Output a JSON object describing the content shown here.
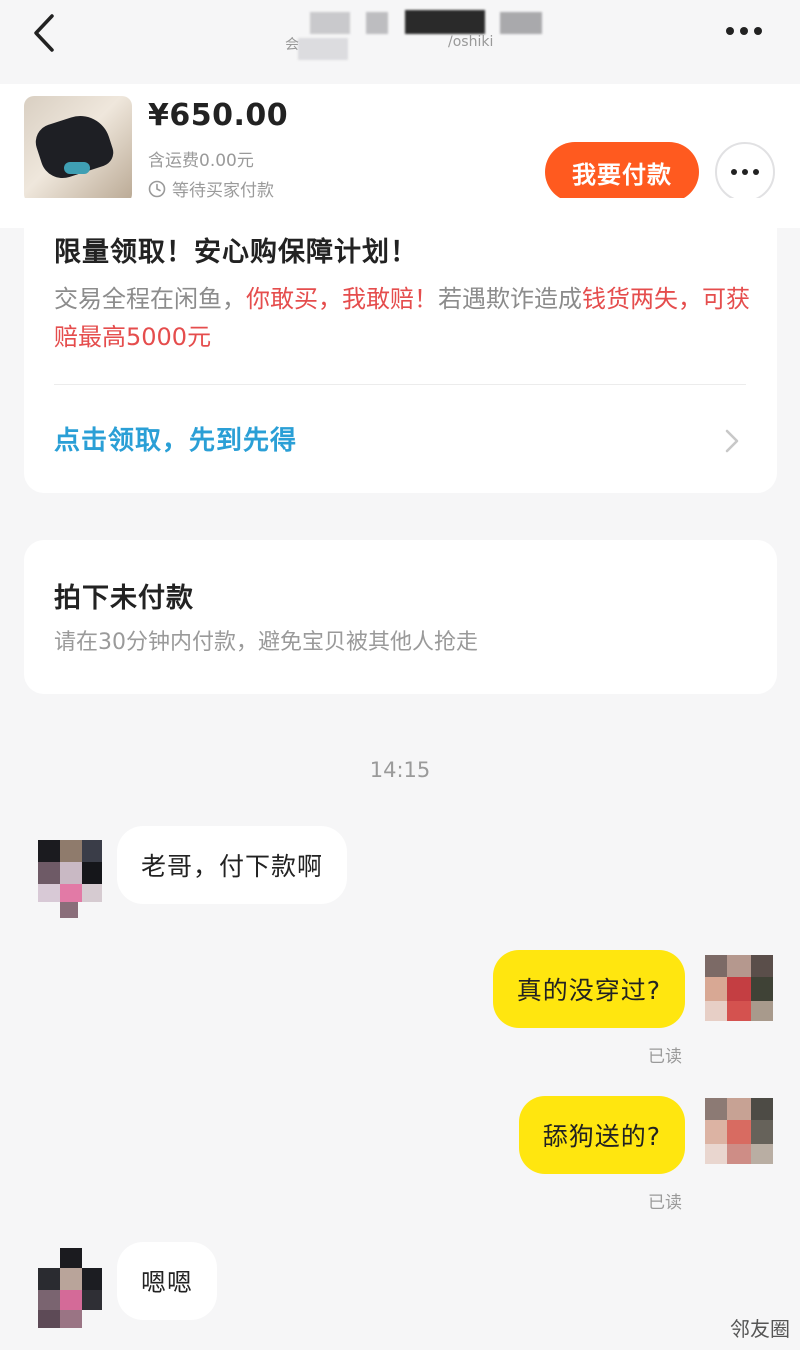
{
  "header": {
    "title_left_fragment": "会",
    "title_right_fragment": "/oshiki",
    "back_icon": "chevron-left-icon",
    "more_icon": "more-horizontal-icon"
  },
  "product": {
    "price": "¥650.00",
    "shipping": "含运费0.00元",
    "status": "等待买家付款",
    "pay_button": "我要付款",
    "accent_color": "#ff5a1f"
  },
  "protection": {
    "title": "限量领取！安心购保障计划！",
    "text_plain_1": "交易全程在闲鱼，",
    "text_red_1": "你敢买，我敢赔！",
    "text_plain_2": "若遇欺诈造成",
    "text_red_2": "钱货两失，可获赔最高5000元",
    "claim_link": "点击领取，先到先得",
    "link_color": "#2a9fd6"
  },
  "unpaid": {
    "title": "拍下未付款",
    "description": "请在30分钟内付款，避免宝贝被其他人抢走"
  },
  "chat": {
    "timestamp": "14:15",
    "messages": [
      {
        "side": "left",
        "text": "老哥，付下款啊"
      },
      {
        "side": "right",
        "text": "真的没穿过?",
        "status": "已读"
      },
      {
        "side": "right",
        "text": "舔狗送的?",
        "status": "已读"
      },
      {
        "side": "left",
        "text": "嗯嗯"
      }
    ]
  },
  "watermark": "邻友圈"
}
